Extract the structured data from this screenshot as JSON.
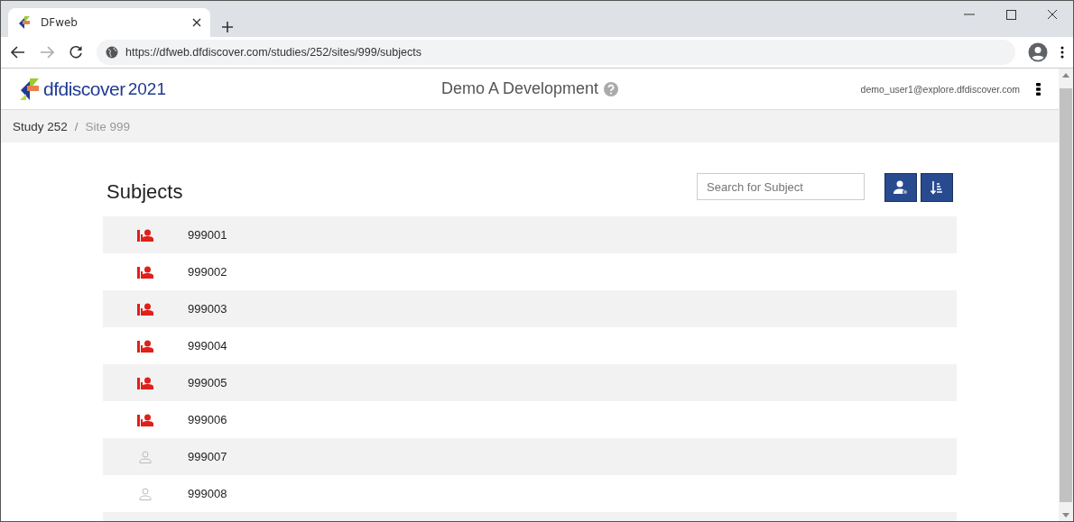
{
  "browser": {
    "tab_title": "DFweb",
    "url": "https://dfweb.dfdiscover.com/studies/252/sites/999/subjects"
  },
  "header": {
    "logo_text": "dfdiscover",
    "logo_year": "2021",
    "title": "Demo A Development",
    "user": "demo_user1@explore.dfdiscover.com"
  },
  "breadcrumb_separator": "/",
  "breadcrumb": [
    {
      "label": "Study 252",
      "current": false
    },
    {
      "label": "Site 999",
      "current": true
    }
  ],
  "subjects": {
    "title": "Subjects",
    "search": {
      "placeholder": "Search for Subject"
    },
    "rows": [
      {
        "id": "999001",
        "kind": "active"
      },
      {
        "id": "999002",
        "kind": "active"
      },
      {
        "id": "999003",
        "kind": "active"
      },
      {
        "id": "999004",
        "kind": "active"
      },
      {
        "id": "999005",
        "kind": "active"
      },
      {
        "id": "999006",
        "kind": "active"
      },
      {
        "id": "999007",
        "kind": "empty"
      },
      {
        "id": "999008",
        "kind": "empty"
      }
    ]
  }
}
